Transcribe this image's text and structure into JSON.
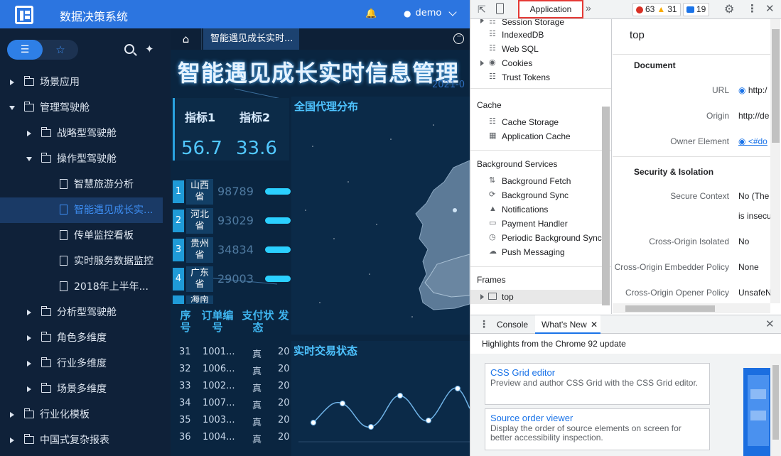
{
  "app": {
    "title": "数据决策系统",
    "user": "demo"
  },
  "sidebar": {
    "items": [
      {
        "label": "场景应用"
      },
      {
        "label": "管理驾驶舱"
      },
      {
        "label": "战略型驾驶舱"
      },
      {
        "label": "操作型驾驶舱"
      },
      {
        "label": "智慧旅游分析"
      },
      {
        "label": "智能遇见成长实..."
      },
      {
        "label": "传单监控看板"
      },
      {
        "label": "实时服务数据监控"
      },
      {
        "label": "2018年上半年..."
      },
      {
        "label": "分析型驾驶舱"
      },
      {
        "label": "角色多维度"
      },
      {
        "label": "行业多维度"
      },
      {
        "label": "场景多维度"
      },
      {
        "label": "行业化模板"
      },
      {
        "label": "中国式复杂报表"
      }
    ]
  },
  "tabs": {
    "current": "智能遇见成长实时..."
  },
  "dashboard": {
    "title": "智能遇见成长实时信息管理",
    "date": "2021-0",
    "kpi": [
      {
        "label": "指标1",
        "value": "56.7"
      },
      {
        "label": "指标2",
        "value": "33.6"
      }
    ],
    "ranking": [
      {
        "rank": "1",
        "province": "山西省",
        "value": "98789"
      },
      {
        "rank": "2",
        "province": "河北省",
        "value": "93029"
      },
      {
        "rank": "3",
        "province": "贵州省",
        "value": "34834"
      },
      {
        "rank": "4",
        "province": "广东省",
        "value": "29003"
      },
      {
        "rank": "",
        "province": "海南",
        "value": ""
      }
    ],
    "map_title": "全国代理分布",
    "table": {
      "headers": [
        "序号",
        "订单编号",
        "支付状态",
        "发"
      ],
      "rows": [
        {
          "no": "31",
          "id": "1001...",
          "status": "真",
          "extra": "20"
        },
        {
          "no": "32",
          "id": "1006...",
          "status": "真",
          "extra": "20"
        },
        {
          "no": "33",
          "id": "1002...",
          "status": "真",
          "extra": "20"
        },
        {
          "no": "34",
          "id": "1007...",
          "status": "真",
          "extra": "20"
        },
        {
          "no": "35",
          "id": "1003...",
          "status": "真",
          "extra": "20"
        },
        {
          "no": "36",
          "id": "1004...",
          "status": "真",
          "extra": "20"
        }
      ]
    },
    "trade_title": "实时交易状态"
  },
  "devtools": {
    "active_tab": "Application",
    "errors": "63",
    "warnings": "31",
    "messages": "19",
    "nav": {
      "storage": [
        "Session Storage",
        "IndexedDB",
        "Web SQL",
        "Cookies",
        "Trust Tokens"
      ],
      "cache_header": "Cache",
      "cache": [
        "Cache Storage",
        "Application Cache"
      ],
      "bg_header": "Background Services",
      "bg": [
        "Background Fetch",
        "Background Sync",
        "Notifications",
        "Payment Handler",
        "Periodic Background Sync",
        "Push Messaging"
      ],
      "frames_header": "Frames",
      "frames": [
        "top"
      ]
    },
    "pane": {
      "frame": "top",
      "document_header": "Document",
      "url_label": "URL",
      "url_value": "http:/",
      "origin_label": "Origin",
      "origin_value": "http://de",
      "owner_label": "Owner Element",
      "owner_value": "<#do",
      "security_header": "Security & Isolation",
      "secure_label": "Secure Context",
      "secure_value": "No  (The",
      "secure_value2": "is insecu",
      "coi_label": "Cross-Origin Isolated",
      "coi_value": "No",
      "coep_label": "Cross-Origin Embedder Policy",
      "coep_value": "None",
      "coop_label": "Cross-Origin Opener Policy",
      "coop_value": "UnsafeN"
    },
    "drawer": {
      "tabs": [
        "Console",
        "What's New"
      ],
      "highlights": "Highlights from the Chrome 92 update",
      "cards": [
        {
          "title": "CSS Grid editor",
          "desc": "Preview and author CSS Grid with the CSS Grid editor."
        },
        {
          "title": "Source order viewer",
          "desc": "Display the order of source elements on screen for better accessibility inspection."
        }
      ]
    }
  }
}
